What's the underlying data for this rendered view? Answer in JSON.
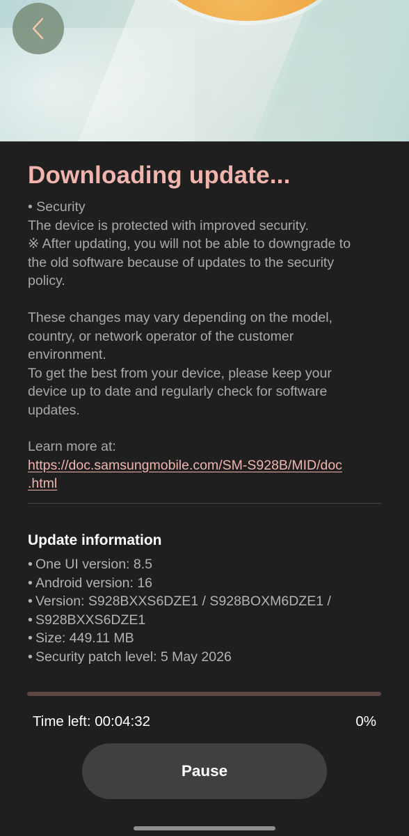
{
  "header": {
    "back_icon": "chevron-left-icon"
  },
  "title": "Downloading update...",
  "release_notes": {
    "lines_p1": [
      "• Security",
      "The device is protected with improved security.",
      "※ After updating, you will not be able to downgrade to",
      "the old software because of updates to the security",
      "policy."
    ],
    "lines_p2": [
      "These changes may vary depending on the model,",
      "country, or network operator of the customer",
      "environment.",
      "To get the best from your device, please keep your",
      "device up to date and regularly check for software",
      "updates."
    ],
    "learn_more_label": "Learn more at:",
    "link_line1": "https://doc.samsungmobile.com/SM-S928B/MID/doc",
    "link_line2": ".html"
  },
  "update_info": {
    "heading": "Update information",
    "items": [
      "One UI version: 8.5",
      "Android version: 16",
      "Version: S928BXXS6DZE1 / S928BOXM6DZE1 /",
      "S928BXXS6DZE1",
      "Size: 449.11 MB",
      "Security patch level: 5 May 2026"
    ]
  },
  "download": {
    "progress_percent": 0,
    "time_left": "Time left: 00:04:32",
    "percent_label": "0%",
    "pause_label": "Pause"
  },
  "colors": {
    "accent": "#f1b5ae",
    "background": "#1f1f1f",
    "progress_track": "#5c4744"
  }
}
